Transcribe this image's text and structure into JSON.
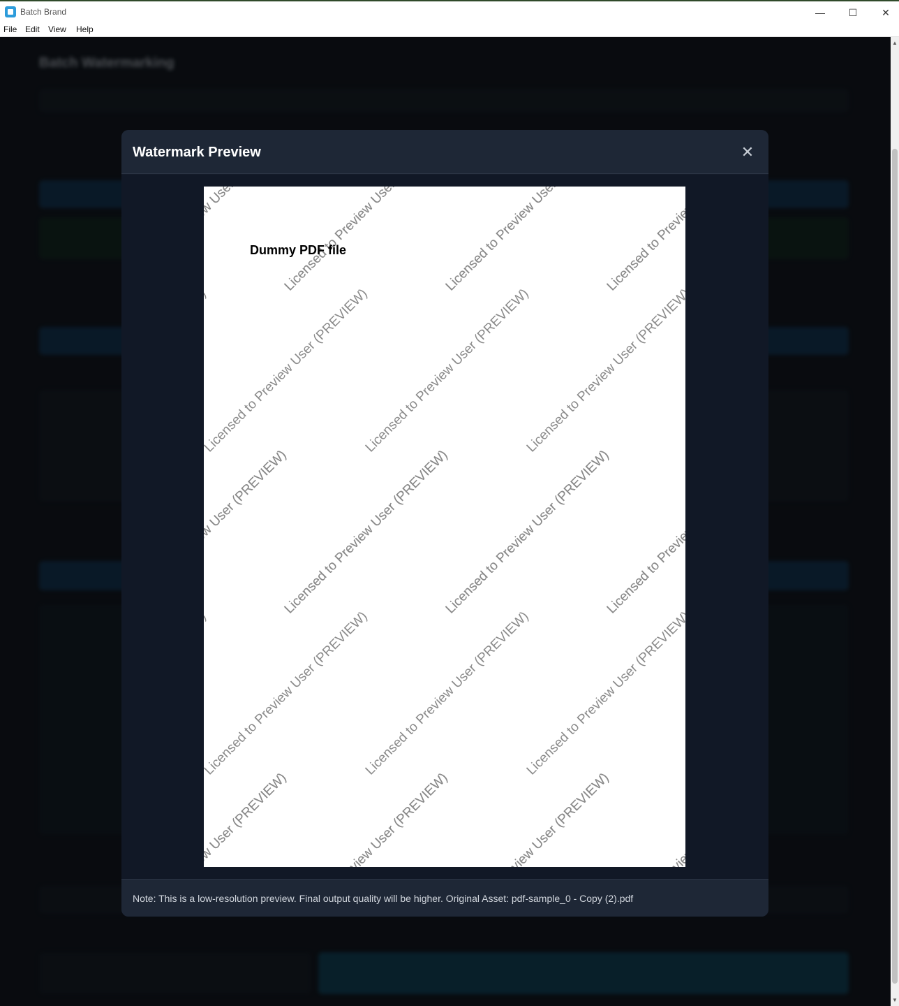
{
  "window": {
    "title": "Batch Brand",
    "minimize_glyph": "—",
    "maximize_glyph": "☐",
    "close_glyph": "✕"
  },
  "menu": [
    "File",
    "Edit",
    "View",
    "Help"
  ],
  "background_app": {
    "heading": "Batch Watermarking"
  },
  "modal": {
    "title": "Watermark Preview",
    "close_glyph": "✕",
    "document_title": "Dummy PDF file",
    "watermark_text": "Licensed to Preview User (PREVIEW)",
    "footer_note": "Note: This is a low-resolution preview. Final output quality will be higher. Original Asset: pdf-sample_0 - Copy (2).pdf"
  },
  "icons": {
    "app": "app-icon",
    "close": "close-icon"
  },
  "colors": {
    "modal_bg": "#151c2a",
    "modal_header": "#1e2736",
    "watermark": "#8a8a8a",
    "app_icon": "#2d9cdb"
  }
}
